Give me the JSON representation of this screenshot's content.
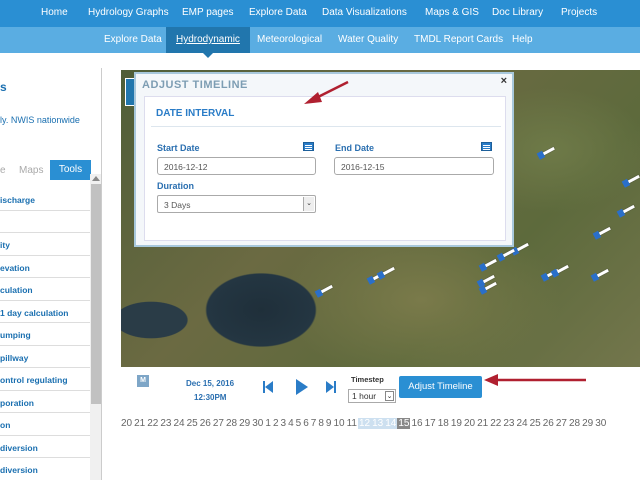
{
  "topnav": [
    "Home",
    "Hydrology Graphs",
    "EMP pages",
    "Explore Data",
    "Data Visualizations",
    "Maps & GIS",
    "Doc Library",
    "Projects"
  ],
  "subnav": [
    "Explore Data",
    "Hydrodynamic",
    "Meteorological",
    "Water Quality",
    "TMDL Report Cards",
    "Help"
  ],
  "sidebar": {
    "title": "s",
    "desc": "ly. NWIS nationwide",
    "tabs": [
      "e",
      "Maps"
    ],
    "tools_label": "Tools",
    "items": [
      "ischarge",
      "",
      "ity",
      "evation",
      "culation",
      "1 day calculation",
      "umping",
      "pillway",
      "ontrol regulating",
      "poration",
      "on",
      "diversion",
      "diversion"
    ]
  },
  "dialog": {
    "title": "ADJUST TIMELINE",
    "close": "×",
    "subtitle": "DATE INTERVAL",
    "start_label": "Start Date",
    "start_value": "2016-12-12",
    "end_label": "End Date",
    "end_value": "2016-12-15",
    "duration_label": "Duration",
    "duration_value": "3 Days",
    "sel_arrow": "⌄"
  },
  "controls": {
    "date": "Dec 15, 2016",
    "time": "12:30PM",
    "timestep_label": "Timestep",
    "timestep_value": "1 hour",
    "m_button": "M",
    "adjust_label": "Adjust Timeline"
  },
  "days": [
    "20",
    "21",
    "22",
    "23",
    "24",
    "25",
    "26",
    "27",
    "28",
    "29",
    "30",
    "1",
    "2",
    "3",
    "4",
    "5",
    "6",
    "7",
    "8",
    "9",
    "10",
    "11",
    "12",
    "13",
    "14",
    "15",
    "16",
    "17",
    "18",
    "19",
    "20",
    "21",
    "22",
    "23",
    "24",
    "25",
    "26",
    "27",
    "28",
    "29",
    "30"
  ],
  "colors": {
    "nav": "#2a8fd3",
    "subnav": "#5aade2",
    "accent": "#2a7cc7",
    "annotation": "#b02030"
  }
}
